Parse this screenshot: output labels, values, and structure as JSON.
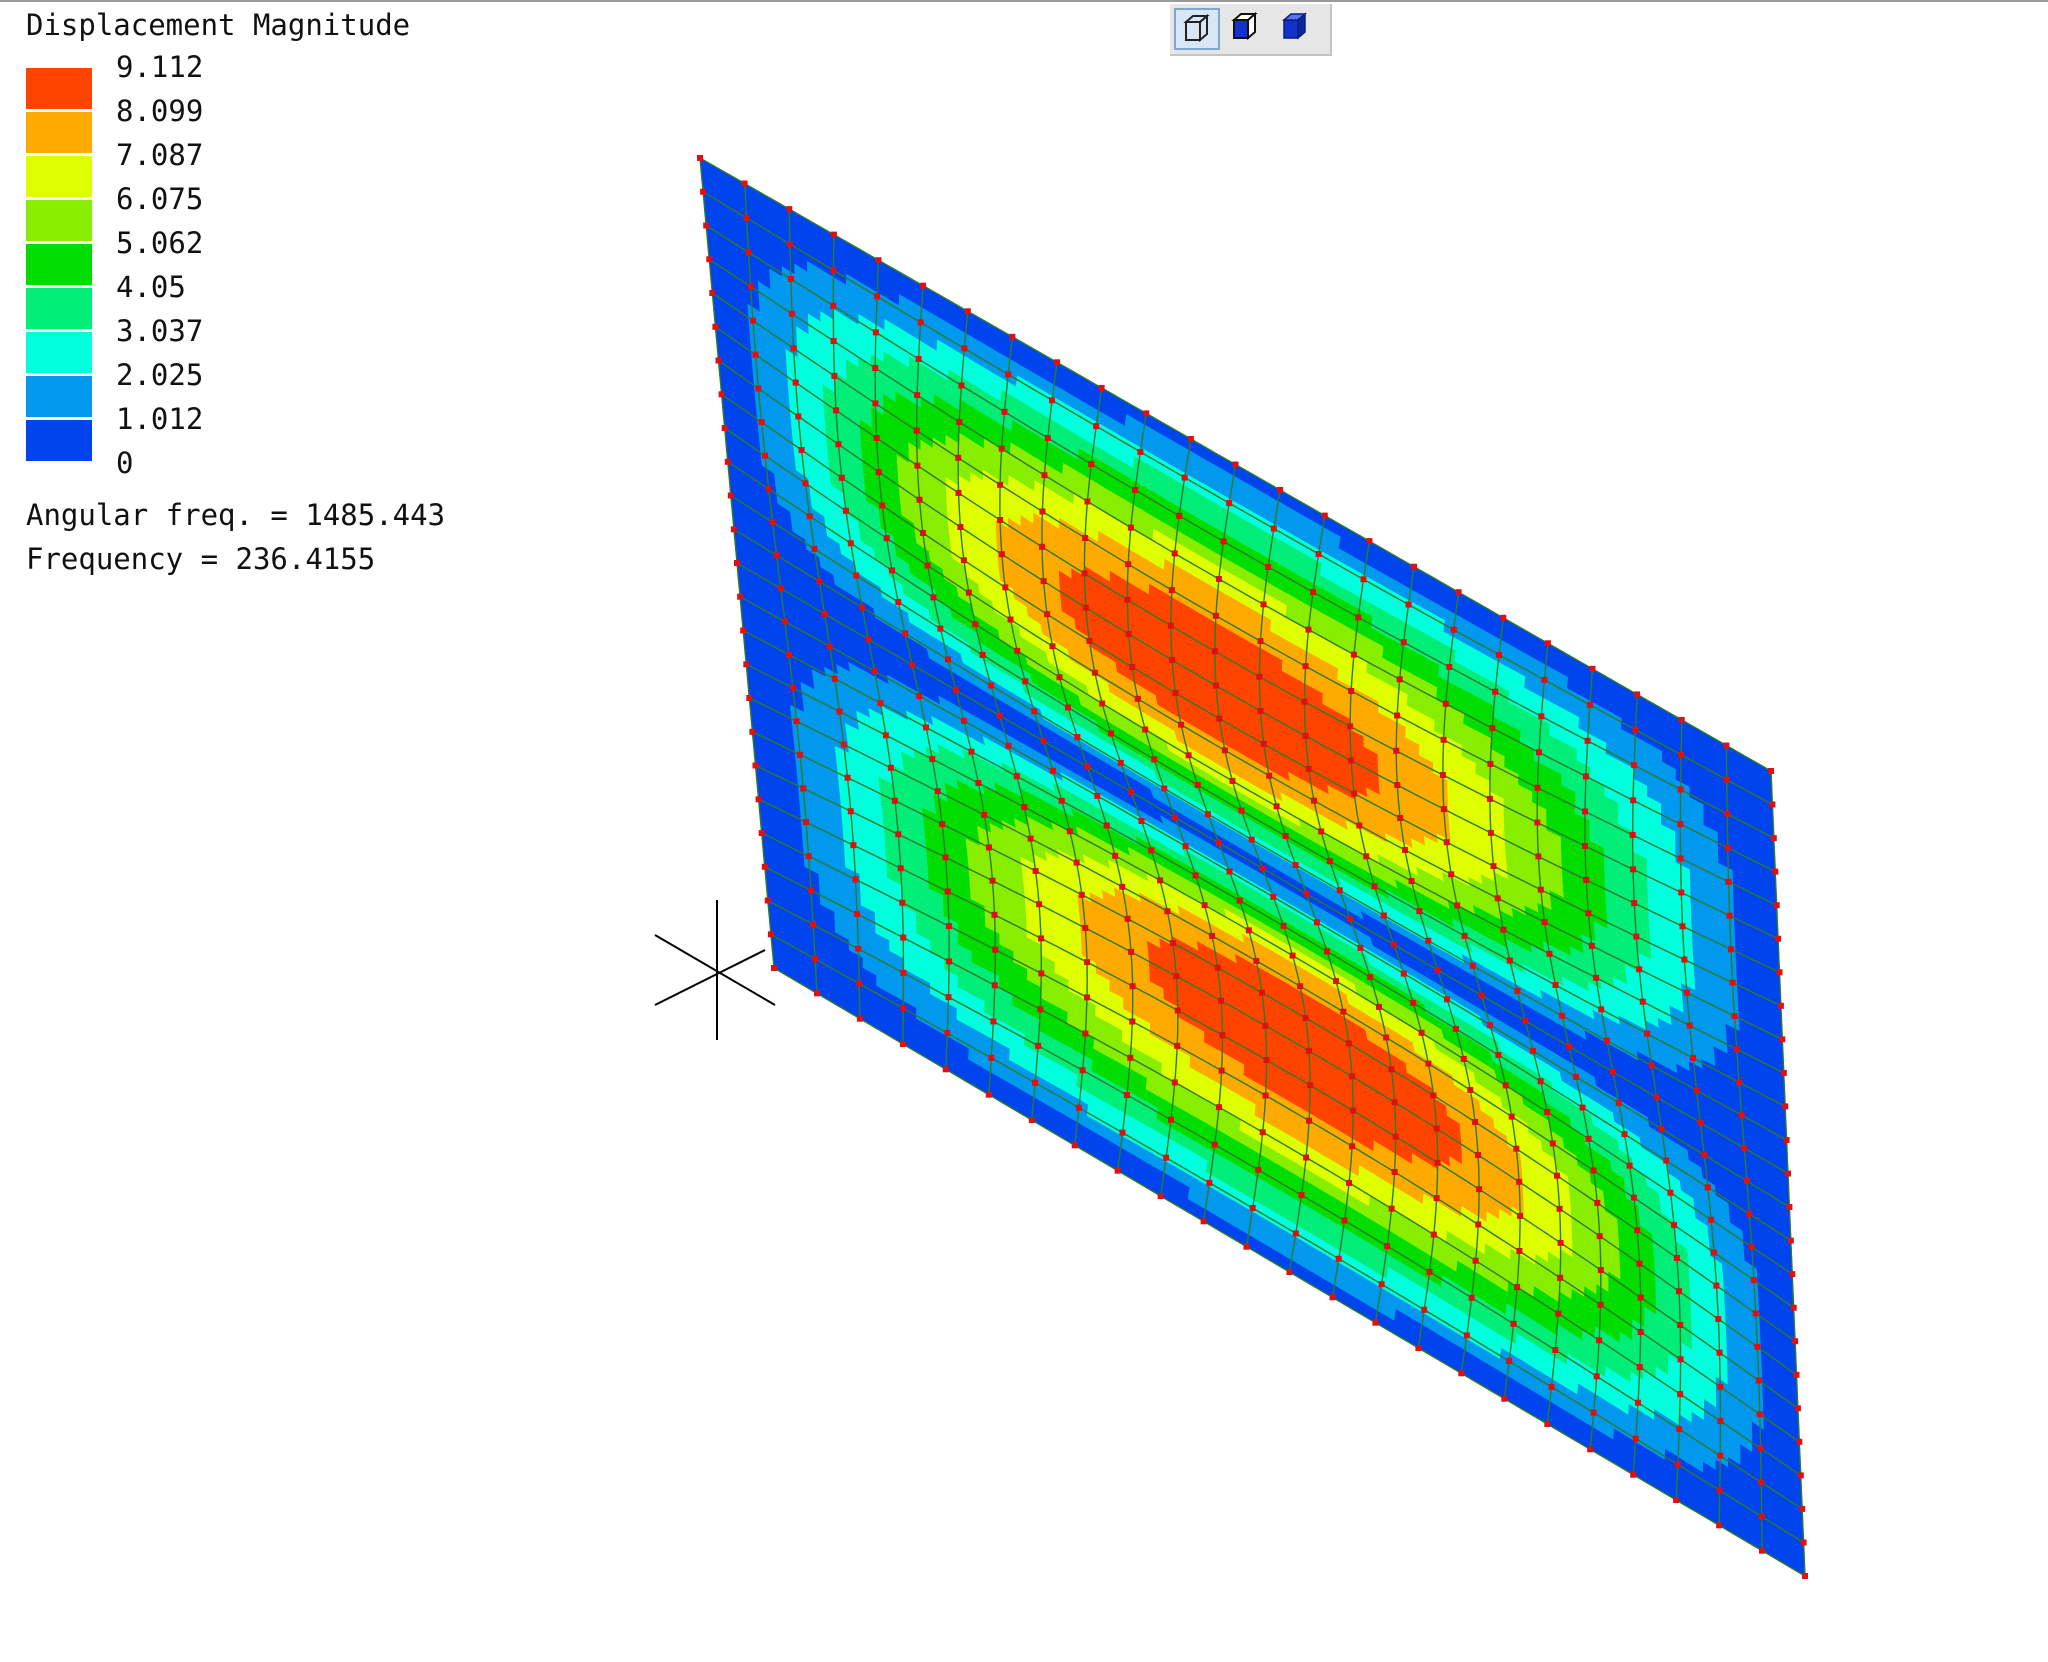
{
  "legend": {
    "title": "Displacement Magnitude",
    "entries": [
      {
        "label": "9.112",
        "color": "#ff4400"
      },
      {
        "label": "8.099",
        "color": "#ffaa00"
      },
      {
        "label": "7.087",
        "color": "#ddff00"
      },
      {
        "label": "6.075",
        "color": "#88ee00"
      },
      {
        "label": "5.062",
        "color": "#00dd00"
      },
      {
        "label": "4.05",
        "color": "#00ee77"
      },
      {
        "label": "3.037",
        "color": "#00ffdd"
      },
      {
        "label": "2.025",
        "color": "#0099ee"
      },
      {
        "label": "1.012",
        "color": "#0044ee"
      },
      {
        "label": "0",
        "color": null
      }
    ]
  },
  "info": {
    "angular_freq": "Angular freq. = 1485.443",
    "frequency": "Frequency = 236.4155"
  },
  "toolbar": {
    "buttons": [
      {
        "name": "wireframe-view-icon",
        "active": true
      },
      {
        "name": "shaded-edges-view-icon",
        "active": false
      },
      {
        "name": "solid-view-icon",
        "active": false
      }
    ]
  },
  "colors": {
    "mesh_line": "#2e7a2a",
    "node_dot": "#dd1111",
    "axis_line": "#000000"
  }
}
